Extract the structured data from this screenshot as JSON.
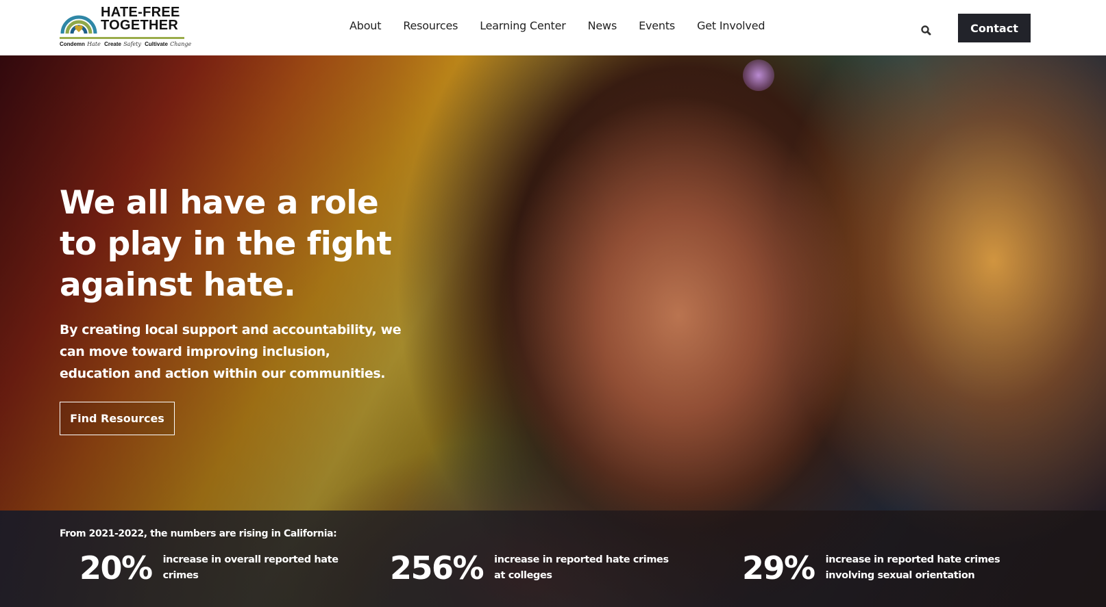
{
  "brand": {
    "title_line1": "HATE-FREE",
    "title_line2": "TOGETHER",
    "tagline": {
      "w1": "Condemn",
      "s1": "Hate",
      "w2": "Create",
      "s2": "Safety",
      "w3": "Cultivate",
      "s3": "Change"
    },
    "colors": {
      "rainbow_outer": "#2f87a6",
      "rainbow_mid": "#8fa84a",
      "rainbow_inner": "#1f5f8a",
      "heart": "#c9a227",
      "bar": "#9aac4a"
    }
  },
  "nav": {
    "items": [
      {
        "label": "About"
      },
      {
        "label": "Resources"
      },
      {
        "label": "Learning Center"
      },
      {
        "label": "News"
      },
      {
        "label": "Events"
      },
      {
        "label": "Get Involved"
      }
    ],
    "search_icon": "search-icon",
    "contact_label": "Contact"
  },
  "hero": {
    "title": "We all have a role to play in the fight against hate.",
    "subtitle": "By creating local support and accountability, we can move toward improving inclusion, education and action within our communities.",
    "cta_label": "Find Resources"
  },
  "stats": {
    "intro": "From 2021-2022, the numbers are rising in California:",
    "items": [
      {
        "value": "20%",
        "label": "increase in overall reported hate crimes"
      },
      {
        "value": "256%",
        "label": "increase in reported hate crimes at colleges"
      },
      {
        "value": "29%",
        "label": "increase in reported hate crimes involving sexual orientation"
      }
    ]
  }
}
